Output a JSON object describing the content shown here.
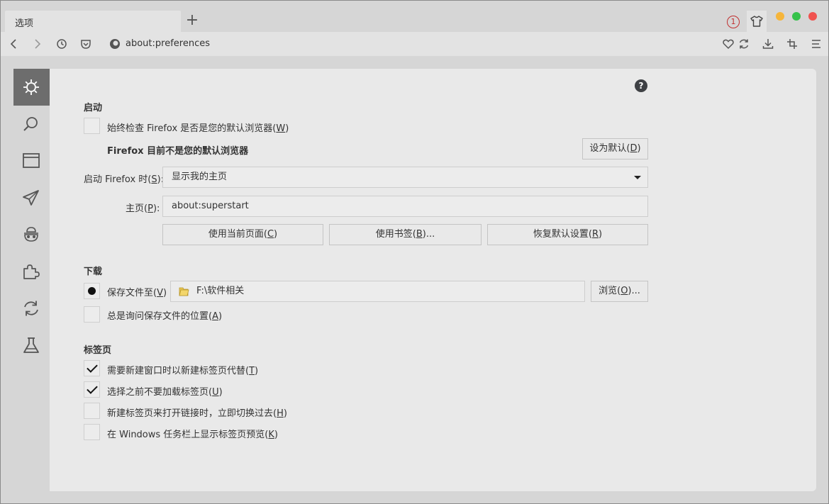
{
  "tab": {
    "title": "选项"
  },
  "tabstrip": {
    "new_tab_glyph": "+",
    "badge_count": "1"
  },
  "toolbar": {
    "url": "about:preferences"
  },
  "sidebar": {
    "items": [
      {
        "icon": "gear-icon",
        "active": true
      },
      {
        "icon": "search-icon"
      },
      {
        "icon": "window-icon"
      },
      {
        "icon": "paper-plane-icon"
      },
      {
        "icon": "mask-icon"
      },
      {
        "icon": "puzzle-icon"
      },
      {
        "icon": "sync-icon"
      },
      {
        "icon": "flask-icon"
      }
    ]
  },
  "help_glyph": "?",
  "startup": {
    "title": "启动",
    "always_check_label": "始终检查 Firefox 是否是您的默认浏览器",
    "always_check_key": "W",
    "status": "Firefox 目前不是您的默认浏览器",
    "set_default_label": "设为默认",
    "set_default_key": "D",
    "when_starts_label": "启动 Firefox 时",
    "when_starts_key": "S",
    "when_starts_value": "显示我的主页",
    "homepage_label": "主页",
    "homepage_key": "P",
    "homepage_value": "about:superstart",
    "use_current_label": "使用当前页面",
    "use_current_key": "C",
    "use_bookmark_label": "使用书签",
    "use_bookmark_key": "B",
    "restore_default_label": "恢复默认设置",
    "restore_default_key": "R"
  },
  "downloads": {
    "title": "下载",
    "save_to_label": "保存文件至",
    "save_to_key": "V",
    "save_path": "F:\\软件相关",
    "browse_label": "浏览",
    "browse_key": "O",
    "always_ask_label": "总是询问保存文件的位置",
    "always_ask_key": "A"
  },
  "tabs": {
    "title": "标签页",
    "options": [
      {
        "label": "需要新建窗口时以新建标签页代替",
        "key": "T",
        "checked": true
      },
      {
        "label": "选择之前不要加载标签页",
        "key": "U",
        "checked": true
      },
      {
        "label": "新建标签页来打开链接时，立即切换过去",
        "key": "H",
        "checked": false
      },
      {
        "label": "在 Windows 任务栏上显示标签页预览",
        "key": "K",
        "checked": false
      }
    ]
  },
  "colors": {
    "accent_active_sidebar": "#6d6d6d",
    "badge_red": "#c03030",
    "traffic_yellow": "#f6b53a",
    "traffic_green": "#36c24a",
    "traffic_red": "#f0524f"
  }
}
